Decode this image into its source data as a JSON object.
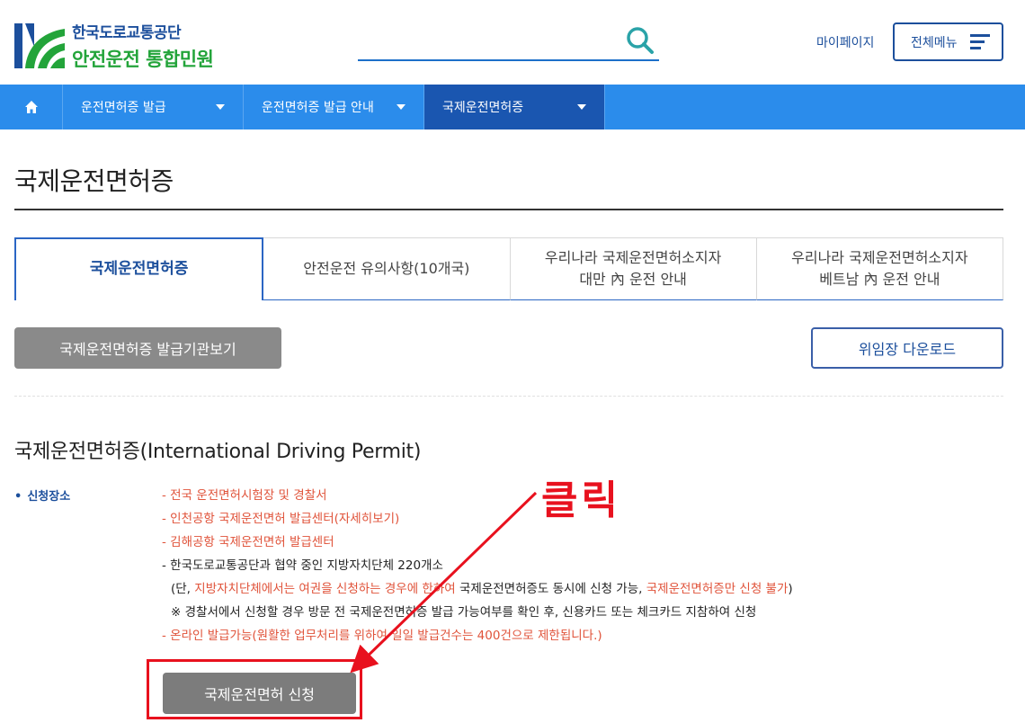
{
  "header": {
    "logo_top": "한국도로교통공단",
    "logo_bottom": "안전운전 통합민원",
    "search_placeholder": "",
    "mypage": "마이페이지",
    "fullmenu": "전체메뉴"
  },
  "nav": {
    "items": [
      {
        "label": "운전면허증 발급"
      },
      {
        "label": "운전면허증 발급 안내"
      },
      {
        "label": "국제운전면허증"
      }
    ]
  },
  "page": {
    "title": "국제운전면허증"
  },
  "tabs": [
    {
      "line1": "국제운전면허증",
      "line2": ""
    },
    {
      "line1": "안전운전 유의사항(10개국)",
      "line2": ""
    },
    {
      "line1": "우리나라 국제운전면허소지자",
      "line2": "대만 內 운전 안내"
    },
    {
      "line1": "우리나라 국제운전면허소지자",
      "line2": "베트남 內 운전 안내"
    }
  ],
  "buttons": {
    "issuers": "국제운전면허증 발급기관보기",
    "download": "위임장 다운로드",
    "apply": "국제운전면허 신청"
  },
  "section": {
    "title": "국제운전면허증(International Driving Permit)",
    "apply_place_label": "신청장소",
    "list": {
      "l1": "- 전국 운전면허시험장 및 경찰서",
      "l2": "- 인천공항 국제운전면허 발급센터(자세히보기)",
      "l3": "- 김해공항 국제운전면허 발급센터",
      "l4": "- 한국도로교통공단과 협약 중인 지방자치단체 220개소",
      "l5a": "(단, ",
      "l5b": "지방자치단체에서는 여권을 신청하는 경우에 한하여",
      "l5c": " 국제운전면허증도 동시에 신청 가능, ",
      "l5d": "국제운전면허증만 신청 불가",
      "l5e": ")",
      "l6": "※ 경찰서에서 신청할 경우 방문 전 국제운전면허증 발급 가능여부를 확인 후, 신용카드 또는 체크카드 지참하여 신청",
      "l7": "- 온라인 발급가능(원활한 업무처리를 위하여 일일 발급건수는 400건으로 제한됩니다.)"
    }
  },
  "annotation": {
    "text": "클릭",
    "color": "#e8111e"
  },
  "colors": {
    "nav_bg": "#2b8ceb",
    "nav_active": "#1a56b0",
    "brand_blue": "#1c4f9c",
    "brand_green": "#23a43a",
    "warning_red": "#e0533a"
  }
}
